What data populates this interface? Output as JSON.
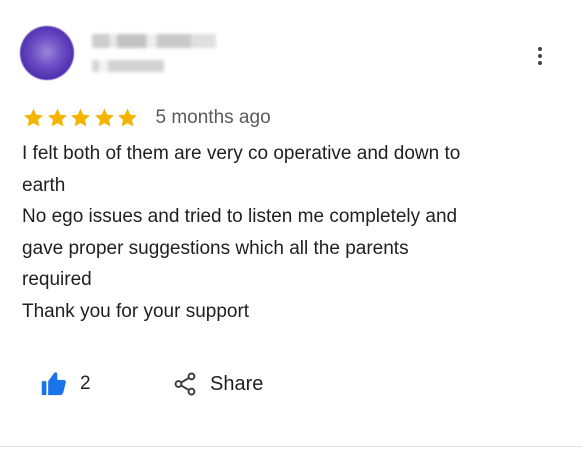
{
  "review": {
    "time_ago": "5 months ago",
    "rating": 5,
    "star_color": "#f5b400",
    "accent_color": "#1a73e8",
    "text_lines": [
      "I felt both of them are very co operative and down to",
      "earth",
      "No ego issues and tried to listen me completely and",
      "gave proper suggestions which all the parents",
      "required",
      "Thank you for your support"
    ]
  },
  "actions": {
    "like_count": "2",
    "share_label": "Share",
    "like_icon": "thumbs-up-icon",
    "share_icon": "share-icon",
    "more_icon": "more-vert-icon"
  }
}
